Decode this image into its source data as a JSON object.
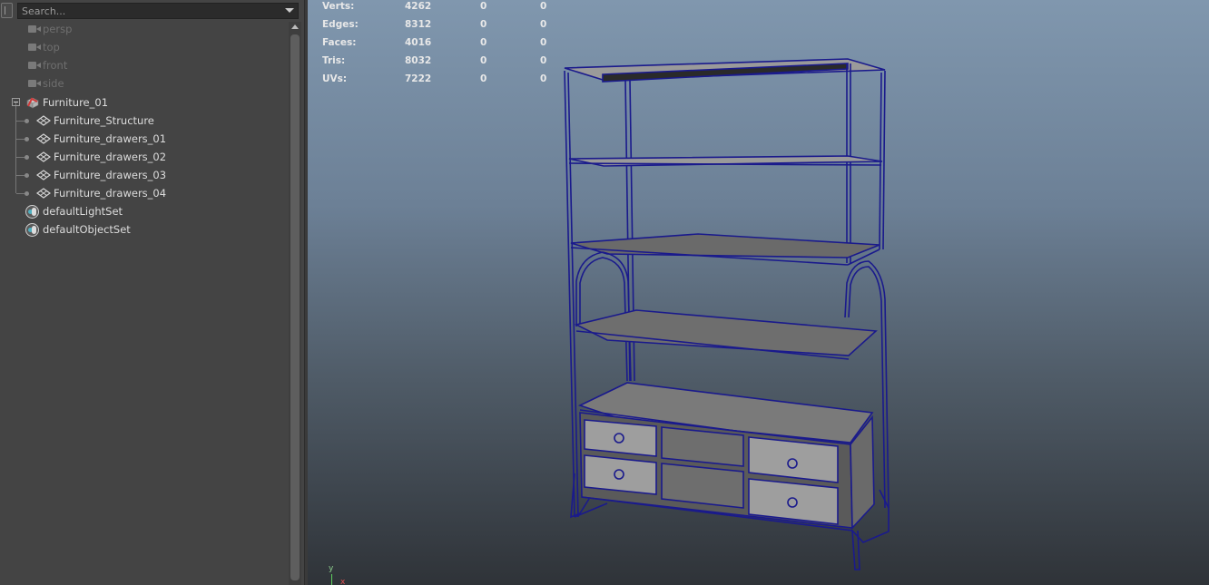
{
  "outliner": {
    "search_placeholder": "Search...",
    "items": [
      {
        "label": "persp",
        "icon": "camera-icon",
        "state": "hidden"
      },
      {
        "label": "top",
        "icon": "camera-icon",
        "state": "hidden"
      },
      {
        "label": "front",
        "icon": "camera-icon",
        "state": "hidden"
      },
      {
        "label": "side",
        "icon": "camera-icon",
        "state": "hidden"
      },
      {
        "label": "Furniture_01",
        "icon": "group-icon",
        "state": "expanded"
      },
      {
        "label": "Furniture_Structure",
        "icon": "mesh-icon"
      },
      {
        "label": "Furniture_drawers_01",
        "icon": "mesh-icon"
      },
      {
        "label": "Furniture_drawers_02",
        "icon": "mesh-icon"
      },
      {
        "label": "Furniture_drawers_03",
        "icon": "mesh-icon"
      },
      {
        "label": "Furniture_drawers_04",
        "icon": "mesh-icon"
      },
      {
        "label": "defaultLightSet",
        "icon": "set-icon"
      },
      {
        "label": "defaultObjectSet",
        "icon": "set-icon"
      }
    ]
  },
  "viewport": {
    "hud": [
      {
        "label": "Verts:",
        "c1": "4262",
        "c2": "0",
        "c3": "0"
      },
      {
        "label": "Edges:",
        "c1": "8312",
        "c2": "0",
        "c3": "0"
      },
      {
        "label": "Faces:",
        "c1": "4016",
        "c2": "0",
        "c3": "0"
      },
      {
        "label": "Tris:",
        "c1": "8032",
        "c2": "0",
        "c3": "0"
      },
      {
        "label": "UVs:",
        "c1": "7222",
        "c2": "0",
        "c3": "0"
      }
    ],
    "axis": {
      "y": "y",
      "x": "x"
    }
  },
  "colors": {
    "panel_bg": "#444444",
    "wire": "#1a1a8c",
    "axis_y": "#5fd05f",
    "axis_x": "#e05050"
  }
}
